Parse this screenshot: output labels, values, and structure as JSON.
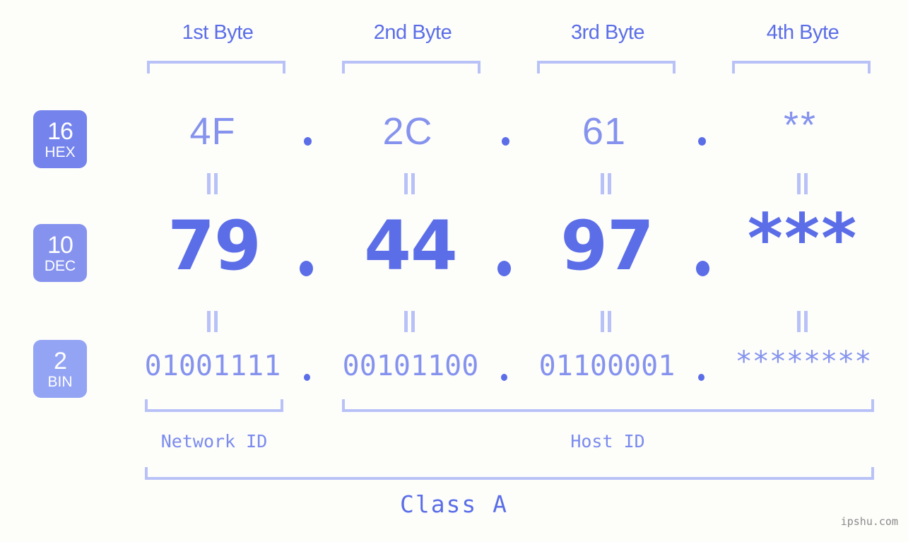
{
  "background_color": "#fdfdfa",
  "accent_color": "#5b6ee8",
  "accent_light_color": "#8593ee",
  "bracket_color": "#b9c2f7",
  "header": {
    "byte_labels": [
      {
        "label": "1st Byte"
      },
      {
        "label": "2nd Byte"
      },
      {
        "label": "3rd Byte"
      },
      {
        "label": "4th Byte"
      }
    ]
  },
  "rows": [
    {
      "badge_number": "16",
      "badge_name": "HEX",
      "badge_color": "#7584ec",
      "values": [
        "4F",
        "2C",
        "61",
        "**"
      ],
      "separator": "."
    },
    {
      "badge_number": "10",
      "badge_name": "DEC",
      "badge_color": "#8593ee",
      "values": [
        "79",
        "44",
        "97",
        "***"
      ],
      "separator": "."
    },
    {
      "badge_number": "2",
      "badge_name": "BIN",
      "badge_color": "#93a4f4",
      "values": [
        "01001111",
        "00101100",
        "01100001",
        "********"
      ],
      "separator": "."
    }
  ],
  "equals_symbol": "=",
  "footer": {
    "network_id_label": "Network ID",
    "host_id_label": "Host ID",
    "class_label": "Class A"
  },
  "watermark": "ipshu.com"
}
